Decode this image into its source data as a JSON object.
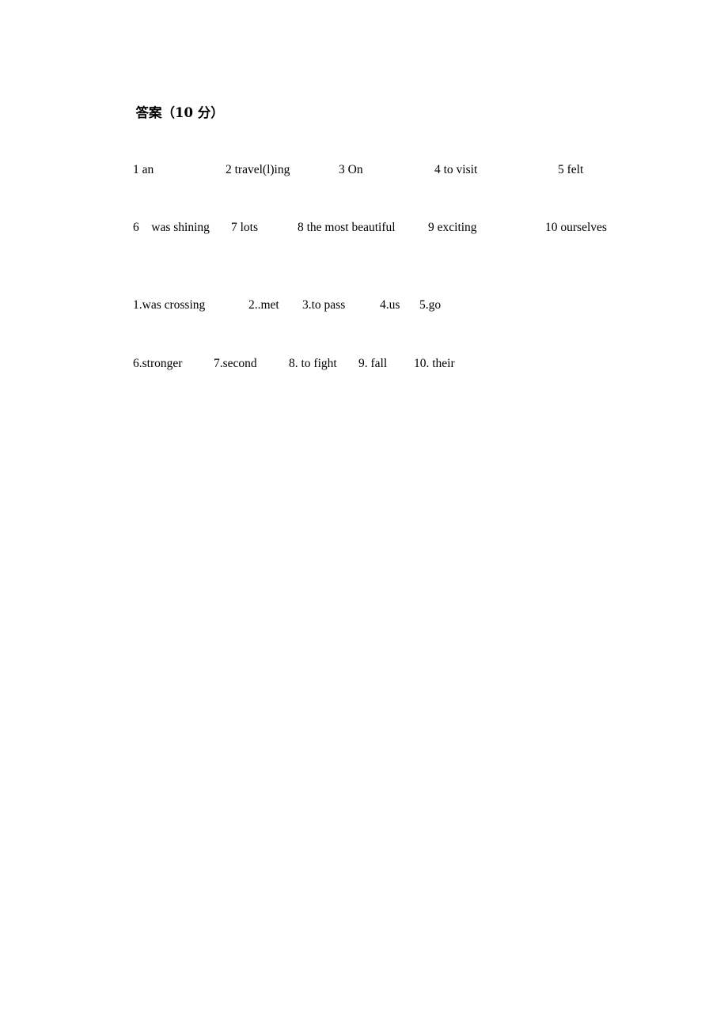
{
  "document": {
    "heading": {
      "label_cjk": "答案",
      "paren_open": "（",
      "score": "10",
      "unit": "分",
      "paren_close": "）",
      "full_text": "答案（10 分）"
    },
    "answer_groups": [
      {
        "group_name": "group-1",
        "lines": [
          {
            "line_name": "line-1",
            "items": [
              {
                "number": "1",
                "text": "1 an",
                "width": 117
              },
              {
                "number": "2",
                "text": "2 travel(l)ing",
                "width": 143
              },
              {
                "number": "3",
                "text": "3 On",
                "width": 121
              },
              {
                "number": "4",
                "text": "4 to visit",
                "width": 156
              },
              {
                "number": "5",
                "text": "5 felt",
                "width": 0
              }
            ]
          },
          {
            "line_name": "line-2",
            "items": [
              {
                "number": "6",
                "text": "6    was shining",
                "width": 124
              },
              {
                "number": "7",
                "text": "7 lots",
                "width": 84
              },
              {
                "number": "8",
                "text": "8 the most beautiful",
                "width": 165
              },
              {
                "number": "9",
                "text": "9 exciting",
                "width": 148
              },
              {
                "number": "10",
                "text": "10 ourselves",
                "width": 0
              }
            ]
          }
        ]
      },
      {
        "group_name": "group-2",
        "lines": [
          {
            "line_name": "line-3",
            "items": [
              {
                "number": "1",
                "text": "1.was crossing",
                "width": 146
              },
              {
                "number": "2",
                "text": "2..met",
                "width": 68
              },
              {
                "number": "3",
                "text": "3.to pass",
                "width": 98
              },
              {
                "number": "4",
                "text": "4.us",
                "width": 50
              },
              {
                "number": "5",
                "text": "5.go",
                "width": 0
              }
            ]
          },
          {
            "line_name": "line-4",
            "items": [
              {
                "number": "6",
                "text": "6.stronger",
                "width": 102
              },
              {
                "number": "7",
                "text": "7.second",
                "width": 95
              },
              {
                "number": "8",
                "text": "8. to fight",
                "width": 88
              },
              {
                "number": "9",
                "text": "9. fall",
                "width": 70
              },
              {
                "number": "10",
                "text": "10. their",
                "width": 0
              }
            ]
          }
        ]
      }
    ]
  }
}
